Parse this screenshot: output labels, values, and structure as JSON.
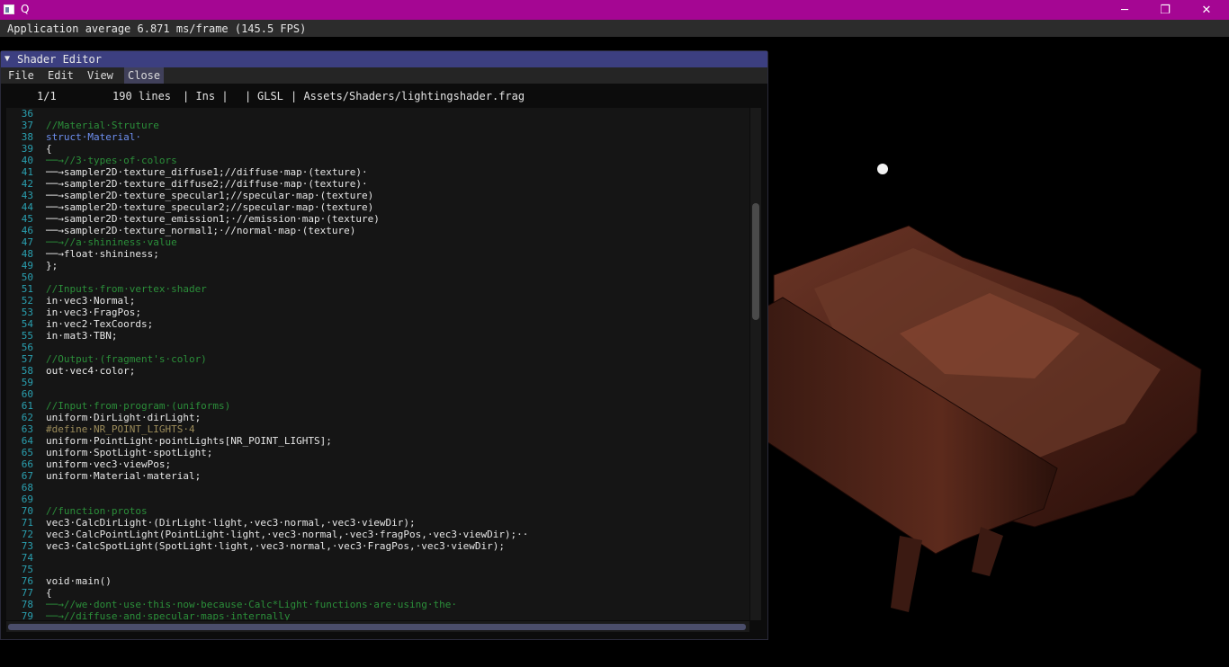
{
  "window": {
    "title": "Q",
    "minimize": "─",
    "restore": "❐",
    "close": "✕"
  },
  "overlay": {
    "fps_text": "Application average 6.871 ms/frame (145.5 FPS)"
  },
  "editor": {
    "title": "Shader Editor",
    "menu": [
      "File",
      "Edit",
      "View",
      "Close"
    ],
    "status": {
      "position": "1/1",
      "lines": "190 lines",
      "mode": "| Ins |",
      "sep": "|",
      "language": "GLSL",
      "file": "| Assets/Shaders/lightingshader.frag"
    },
    "lines": [
      {
        "n": "36",
        "t": "",
        "k": "c-def"
      },
      {
        "n": "37",
        "t": "//Material·Struture",
        "k": "c-comment"
      },
      {
        "n": "38",
        "t": "struct·Material·",
        "k": "c-kw"
      },
      {
        "n": "39",
        "t": "{",
        "k": "c-def"
      },
      {
        "n": "40",
        "t": "──→//3·types·of·colors",
        "k": "c-comment"
      },
      {
        "n": "41",
        "t": "──→sampler2D·texture_diffuse1;//diffuse·map·(texture)·",
        "k": "c-def"
      },
      {
        "n": "42",
        "t": "──→sampler2D·texture_diffuse2;//diffuse·map·(texture)·",
        "k": "c-def"
      },
      {
        "n": "43",
        "t": "──→sampler2D·texture_specular1;//specular·map·(texture)",
        "k": "c-def"
      },
      {
        "n": "44",
        "t": "──→sampler2D·texture_specular2;//specular·map·(texture)",
        "k": "c-def"
      },
      {
        "n": "45",
        "t": "──→sampler2D·texture_emission1;·//emission·map·(texture)",
        "k": "c-def"
      },
      {
        "n": "46",
        "t": "──→sampler2D·texture_normal1;·//normal·map·(texture)",
        "k": "c-def"
      },
      {
        "n": "47",
        "t": "──→//a·shininess·value",
        "k": "c-comment"
      },
      {
        "n": "48",
        "t": "──→float·shininess;",
        "k": "c-def"
      },
      {
        "n": "49",
        "t": "};",
        "k": "c-def"
      },
      {
        "n": "50",
        "t": "",
        "k": "c-def"
      },
      {
        "n": "51",
        "t": "//Inputs·from·vertex·shader",
        "k": "c-comment"
      },
      {
        "n": "52",
        "t": "in·vec3·Normal;",
        "k": "c-def"
      },
      {
        "n": "53",
        "t": "in·vec3·FragPos;",
        "k": "c-def"
      },
      {
        "n": "54",
        "t": "in·vec2·TexCoords;",
        "k": "c-def"
      },
      {
        "n": "55",
        "t": "in·mat3·TBN;",
        "k": "c-def"
      },
      {
        "n": "56",
        "t": "",
        "k": "c-def"
      },
      {
        "n": "57",
        "t": "//Output·(fragment's·color)",
        "k": "c-comment"
      },
      {
        "n": "58",
        "t": "out·vec4·color;",
        "k": "c-def"
      },
      {
        "n": "59",
        "t": "",
        "k": "c-def"
      },
      {
        "n": "60",
        "t": "",
        "k": "c-def"
      },
      {
        "n": "61",
        "t": "//Input·from·program·(uniforms)",
        "k": "c-comment"
      },
      {
        "n": "62",
        "t": "uniform·DirLight·dirLight;",
        "k": "c-def"
      },
      {
        "n": "63",
        "t": "#define·NR_POINT_LIGHTS·4",
        "k": "c-pre"
      },
      {
        "n": "64",
        "t": "uniform·PointLight·pointLights[NR_POINT_LIGHTS];",
        "k": "c-def"
      },
      {
        "n": "65",
        "t": "uniform·SpotLight·spotLight;",
        "k": "c-def"
      },
      {
        "n": "66",
        "t": "uniform·vec3·viewPos;",
        "k": "c-def"
      },
      {
        "n": "67",
        "t": "uniform·Material·material;",
        "k": "c-def"
      },
      {
        "n": "68",
        "t": "",
        "k": "c-def"
      },
      {
        "n": "69",
        "t": "",
        "k": "c-def"
      },
      {
        "n": "70",
        "t": "//function·protos",
        "k": "c-comment"
      },
      {
        "n": "71",
        "t": "vec3·CalcDirLight·(DirLight·light,·vec3·normal,·vec3·viewDir);",
        "k": "c-def"
      },
      {
        "n": "72",
        "t": "vec3·CalcPointLight(PointLight·light,·vec3·normal,·vec3·fragPos,·vec3·viewDir);··",
        "k": "c-def"
      },
      {
        "n": "73",
        "t": "vec3·CalcSpotLight(SpotLight·light,·vec3·normal,·vec3·FragPos,·vec3·viewDir);",
        "k": "c-def"
      },
      {
        "n": "74",
        "t": "",
        "k": "c-def"
      },
      {
        "n": "75",
        "t": "",
        "k": "c-def"
      },
      {
        "n": "76",
        "t": "void·main()",
        "k": "c-def"
      },
      {
        "n": "77",
        "t": "{",
        "k": "c-def"
      },
      {
        "n": "78",
        "t": "──→//we·dont·use·this·now·because·Calc*Light·functions·are·using·the·",
        "k": "c-comment"
      },
      {
        "n": "79",
        "t": "──→//diffuse·and·specular·maps·internally",
        "k": "c-comment"
      }
    ]
  },
  "colors": {
    "title_bar": "#a50693",
    "editor_title": "#3c3f80",
    "comment": "#2b8f3a",
    "keyword": "#6e8ff0",
    "line_number": "#2aa0b0"
  }
}
